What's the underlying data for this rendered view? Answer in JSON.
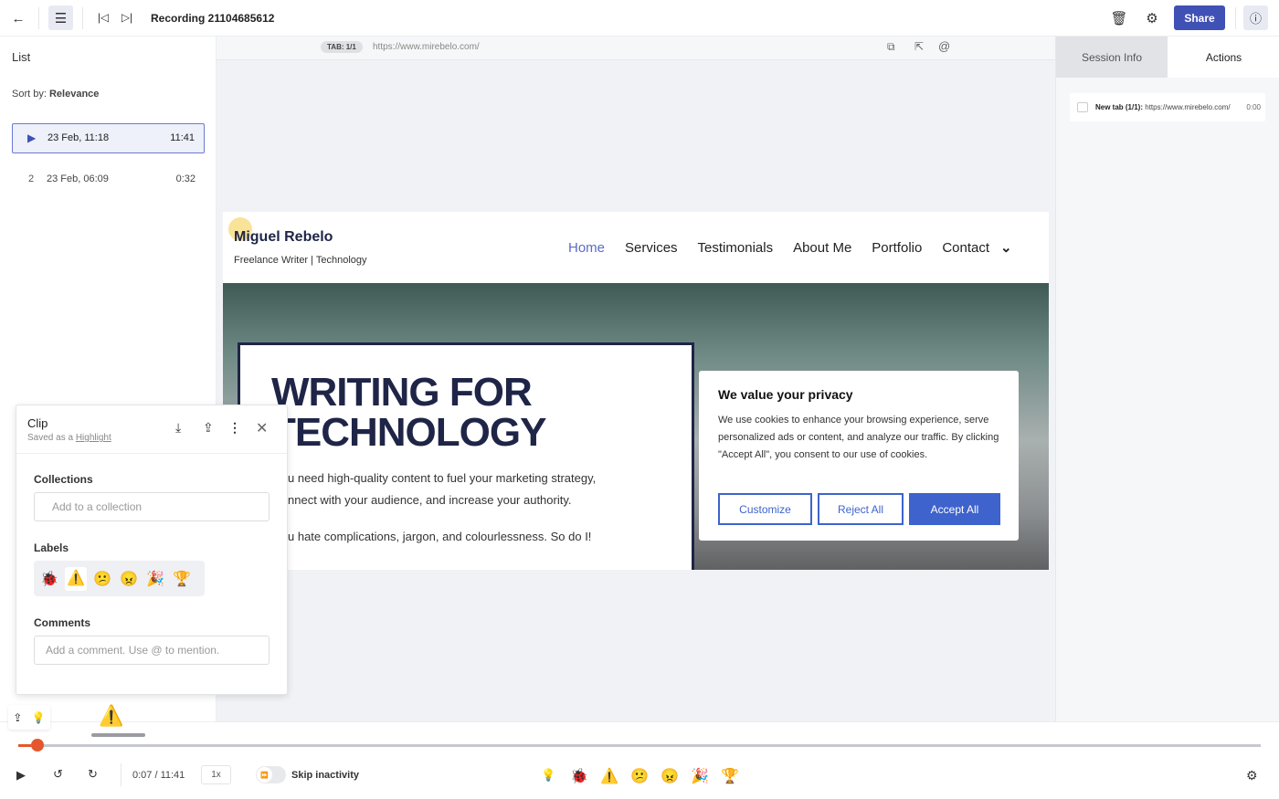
{
  "header": {
    "title": "Recording 21104685612",
    "share_label": "Share",
    "icons": [
      "back-arrow",
      "list",
      "skip-previous",
      "skip-next",
      "trash",
      "extension",
      "info"
    ]
  },
  "sidebar": {
    "title": "List",
    "sort_prefix": "Sort by:",
    "sort_value": "Relevance",
    "items": [
      {
        "index": "",
        "date": "23 Feb, 11:18",
        "duration": "11:41",
        "active": true
      },
      {
        "index": "2",
        "date": "23 Feb, 06:09",
        "duration": "0:32",
        "active": false
      }
    ]
  },
  "viewer": {
    "tab_badge": "TAB: 1/1",
    "url": "https://www.mirebelo.com/"
  },
  "site": {
    "brand": "Miguel Rebelo",
    "tagline": "Freelance Writer | Technology",
    "nav": [
      "Home",
      "Services",
      "Testimonials",
      "About Me",
      "Portfolio",
      "Contact"
    ],
    "hero_line1": "WRITING FOR",
    "hero_line2": "TECHNOLOGY",
    "para1a": "u need high-quality content to fuel your marketing strategy,",
    "para1b": "nnect with your audience, and increase your authority.",
    "para2": "u hate complications, jargon, and colourlessness. So do I!",
    "cookie": {
      "title": "We value your privacy",
      "body": "We use cookies to enhance your browsing experience, serve personalized ads or content, and analyze our traffic. By clicking \"Accept All\", you consent to our use of cookies.",
      "customize": "Customize",
      "reject": "Reject All",
      "accept": "Accept All"
    }
  },
  "right": {
    "tabs": [
      "Session Info",
      "Actions"
    ],
    "active_tab": "Actions",
    "action": {
      "label": "New tab (1/1):",
      "url": "https://www.mirebelo.com/",
      "time": "0:00"
    }
  },
  "clip": {
    "title": "Clip",
    "saved_prefix": "Saved as a",
    "saved_link": "Highlight",
    "collections_label": "Collections",
    "collections_placeholder": "Add to a collection",
    "labels_label": "Labels",
    "labels": [
      "🐞",
      "⚠️",
      "😕",
      "😠",
      "🎉",
      "🏆"
    ],
    "selected_label": "⚠️",
    "comments_label": "Comments",
    "comments_placeholder": "Add a comment. Use @ to mention."
  },
  "player": {
    "time": "0:07 / 11:41",
    "speed": "1x",
    "skip_label": "Skip inactivity",
    "progress": 0.01,
    "marker": "⚠️",
    "reactions": [
      "🐞",
      "⚠️",
      "😕",
      "😠",
      "🎉",
      "🏆"
    ],
    "accent": "#e4572e",
    "brand": "#3f51b5"
  }
}
